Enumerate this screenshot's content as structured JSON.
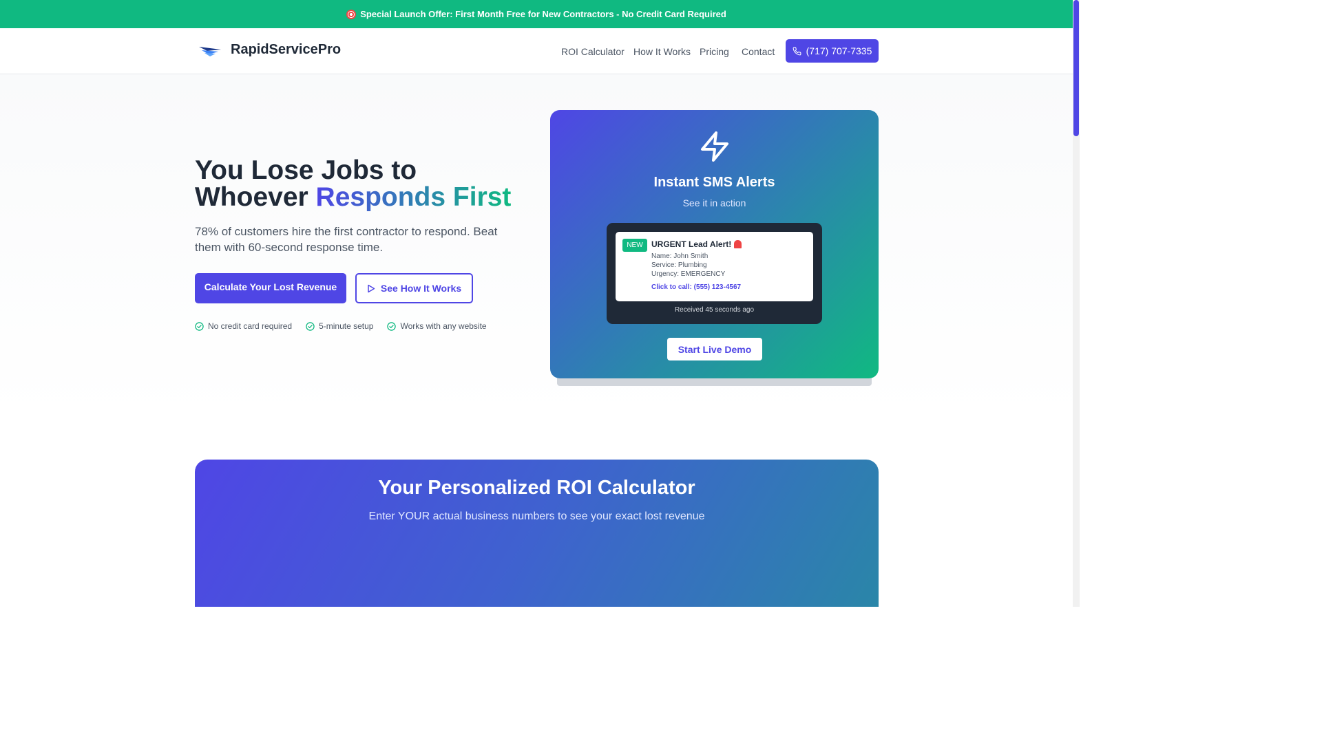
{
  "banner": {
    "icon": "target-icon",
    "text": "Special Launch Offer: First Month Free for New Contractors - No Credit Card Required"
  },
  "nav": {
    "brand": "RapidServicePro",
    "links": [
      "ROI Calculator",
      "How It Works",
      "Pricing",
      "Contact"
    ],
    "phone": "(717) 707-7335"
  },
  "hero": {
    "headline_part1": "You Lose Jobs to",
    "headline_part2": "Whoever ",
    "headline_highlight": "Responds First",
    "subheadline": "78% of customers hire the first contractor to respond. Beat them with 60-second response time.",
    "primary_cta": "Calculate Your Lost Revenue",
    "secondary_cta": "See How It Works",
    "checks": [
      "No credit card required",
      "5-minute setup",
      "Works with any website"
    ]
  },
  "demo": {
    "title": "Instant SMS Alerts",
    "subtitle": "See it in action",
    "badge": "NEW",
    "message_title": "URGENT Lead Alert!",
    "name_line": "Name: John Smith",
    "service_line": "Service: Plumbing",
    "urgency_line": "Urgency: EMERGENCY",
    "call_line": "Click to call: (555) 123-4567",
    "received": "Received 45 seconds ago",
    "button": "Start Live Demo"
  },
  "roi": {
    "title": "Your Personalized ROI Calculator",
    "subtitle": "Enter YOUR actual business numbers to see your exact lost revenue"
  },
  "colors": {
    "primary": "#4f46e5",
    "accent": "#10b981",
    "dark": "#1f2937"
  }
}
